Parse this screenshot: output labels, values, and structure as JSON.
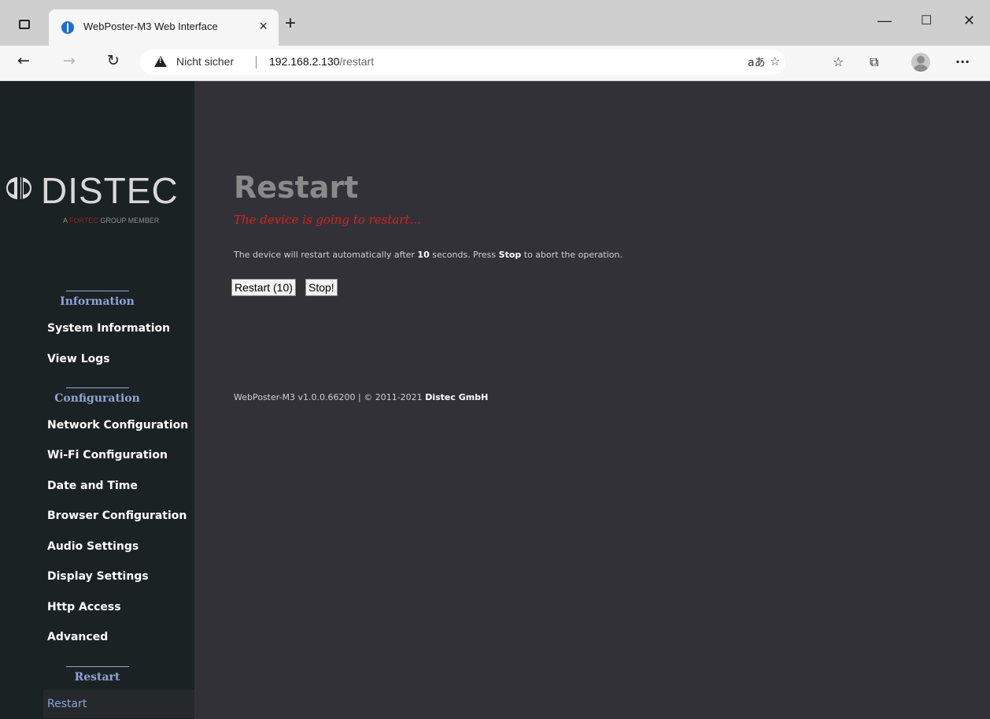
{
  "browser": {
    "tab_title": "WebPoster-M3 Web Interface",
    "tab_close": "×",
    "new_tab": "+",
    "security_label": "Nicht sicher",
    "url_host": "192.168.2.130",
    "url_path": "/restart",
    "window_controls": {
      "minimize": "—",
      "maximize": "☐",
      "close": "✕"
    },
    "icons": [
      "tab-actions-icon",
      "back-icon",
      "forward-icon",
      "refresh-icon",
      "warning-icon",
      "read-aloud-icon",
      "add-favorite-icon",
      "favorites-icon",
      "collections-icon",
      "profile-icon",
      "more-icon"
    ]
  },
  "logo": {
    "word": "DISTEC",
    "tagline_prefix": "A ",
    "tagline_brand": "FORTEC",
    "tagline_suffix": " GROUP MEMBER"
  },
  "sidebar": {
    "sections": [
      {
        "title": "Information",
        "items": [
          "System Information",
          "View Logs"
        ]
      },
      {
        "title": "Configuration",
        "items": [
          "Network Configuration",
          "Wi-Fi Configuration",
          "Date and Time",
          "Browser Configuration",
          "Audio Settings",
          "Display Settings",
          "Http Access",
          "Advanced"
        ]
      },
      {
        "title": "Restart",
        "items": [
          "Restart"
        ]
      }
    ],
    "active_item": "Restart"
  },
  "main": {
    "title": "Restart",
    "subtitle": "The device is going to restart...",
    "info_prefix": "The device will restart automatically after ",
    "info_seconds": "10",
    "info_middle": " seconds. Press ",
    "info_stop": "Stop",
    "info_suffix": " to abort the operation.",
    "restart_button": "Restart (10)",
    "stop_button": "Stop!",
    "footer_text": "WebPoster-M3 v1.0.0.66200 | © 2011-2021 ",
    "footer_company": "Distec GmbH"
  }
}
